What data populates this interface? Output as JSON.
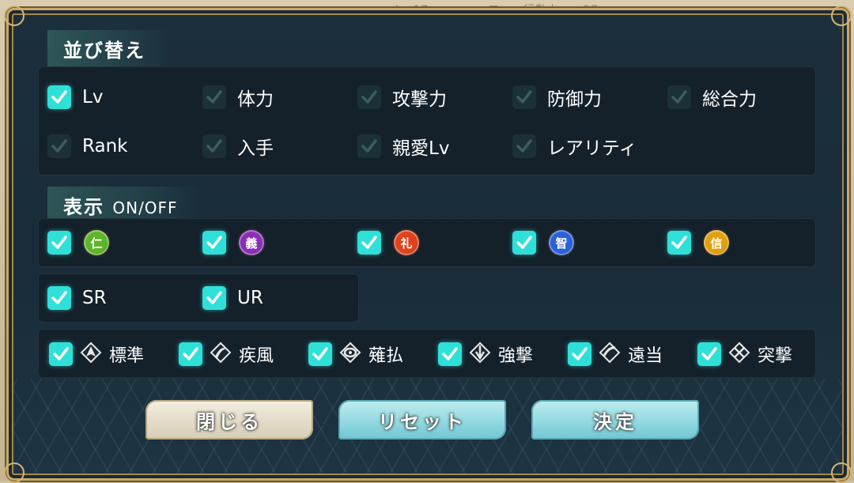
{
  "background_peek": "Lv.17　　　　　ロ　　行動力　　37",
  "sort_section": {
    "title": "並び替え",
    "options": [
      {
        "label": "Lv",
        "checked": true
      },
      {
        "label": "体力",
        "checked": false
      },
      {
        "label": "攻撃力",
        "checked": false
      },
      {
        "label": "防御力",
        "checked": false
      },
      {
        "label": "総合力",
        "checked": false
      },
      {
        "label": "Rank",
        "checked": false
      },
      {
        "label": "入手",
        "checked": false
      },
      {
        "label": "親愛Lv",
        "checked": false
      },
      {
        "label": "レアリティ",
        "checked": false
      }
    ]
  },
  "display_section": {
    "title": "表示",
    "title_suffix": "ON/OFF",
    "attributes": [
      {
        "glyph": "仁",
        "color": "#5fb52a",
        "checked": true
      },
      {
        "glyph": "義",
        "color": "#8a2fb8",
        "checked": true
      },
      {
        "glyph": "礼",
        "color": "#e0421e",
        "checked": true
      },
      {
        "glyph": "智",
        "color": "#2a62d8",
        "checked": true
      },
      {
        "glyph": "信",
        "color": "#e0a012",
        "checked": true
      }
    ],
    "rarities": [
      {
        "label": "SR",
        "checked": true
      },
      {
        "label": "UR",
        "checked": true
      }
    ],
    "weapons": [
      {
        "label": "標準",
        "icon": "standard-weapon-icon",
        "checked": true
      },
      {
        "label": "疾風",
        "icon": "gale-weapon-icon",
        "checked": true
      },
      {
        "label": "薙払",
        "icon": "sweep-weapon-icon",
        "checked": true
      },
      {
        "label": "強撃",
        "icon": "strike-weapon-icon",
        "checked": true
      },
      {
        "label": "遠当",
        "icon": "ranged-weapon-icon",
        "checked": true
      },
      {
        "label": "突撃",
        "icon": "charge-weapon-icon",
        "checked": true
      }
    ]
  },
  "buttons": {
    "close": "閉じる",
    "reset": "リセット",
    "confirm": "決定"
  },
  "colors": {
    "checkbox_on": "#2fe0d8",
    "checkbox_off": "#1b3037",
    "panel": "#14212b",
    "frame_gold": "#c9a866"
  }
}
